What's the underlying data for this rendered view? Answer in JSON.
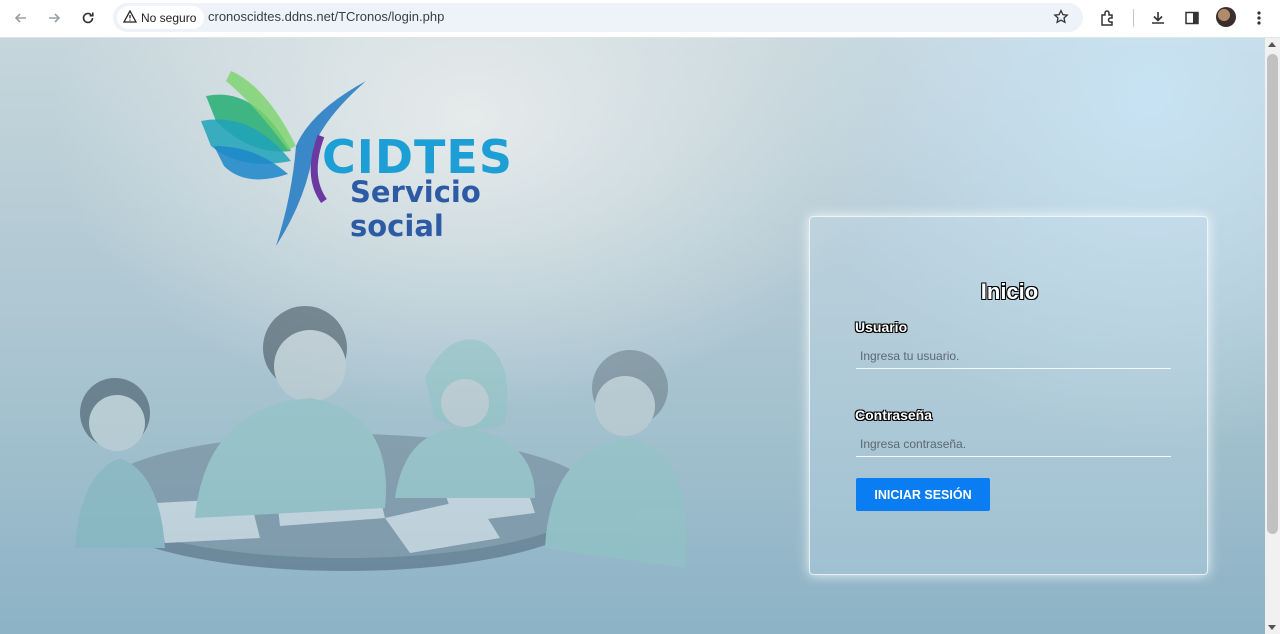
{
  "browser": {
    "security_label": "No seguro",
    "url": "cronoscidtes.ddns.net/TCronos/login.php",
    "icons": [
      "back-icon",
      "forward-icon",
      "reload-icon",
      "warning-icon",
      "star-icon",
      "extensions-icon",
      "download-icon",
      "side-panel-icon",
      "profile-avatar",
      "menu-icon"
    ]
  },
  "logo": {
    "name": "CIDTES",
    "subtitle": "Servicio social",
    "colors": {
      "name": "#1d9fd6",
      "subtitle": "#2d5aa5",
      "wing_green": "#2fb07a",
      "wing_blue": "#1c86c9"
    }
  },
  "login": {
    "title": "Inicio",
    "username_label": "Usuario",
    "username_placeholder": "Ingresa tu usuario.",
    "password_label": "Contraseña",
    "password_placeholder": "Ingresa contraseña.",
    "submit_label": "INICIAR SESIÓN",
    "button_color": "#0a7df2"
  }
}
